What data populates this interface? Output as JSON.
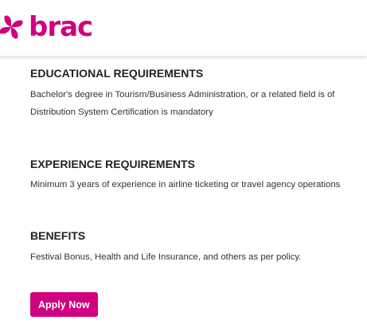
{
  "brand": {
    "name": "brac",
    "color": "#d0007e"
  },
  "sections": {
    "education": {
      "heading": "EDUCATIONAL REQUIREMENTS",
      "line1": "Bachelor's degree in Tourism/Business Administration, or a related field is of",
      "line2": "Distribution System Certification is mandatory"
    },
    "experience": {
      "heading": "EXPERIENCE REQUIREMENTS",
      "line1": "Minimum 3 years of experience in airline ticketing or travel agency operations"
    },
    "benefits": {
      "heading": "BENEFITS",
      "line1": "Festival Bonus, Health and Life Insurance, and others as per policy."
    }
  },
  "apply_button": {
    "label": "Apply Now",
    "color": "#d0007e"
  }
}
